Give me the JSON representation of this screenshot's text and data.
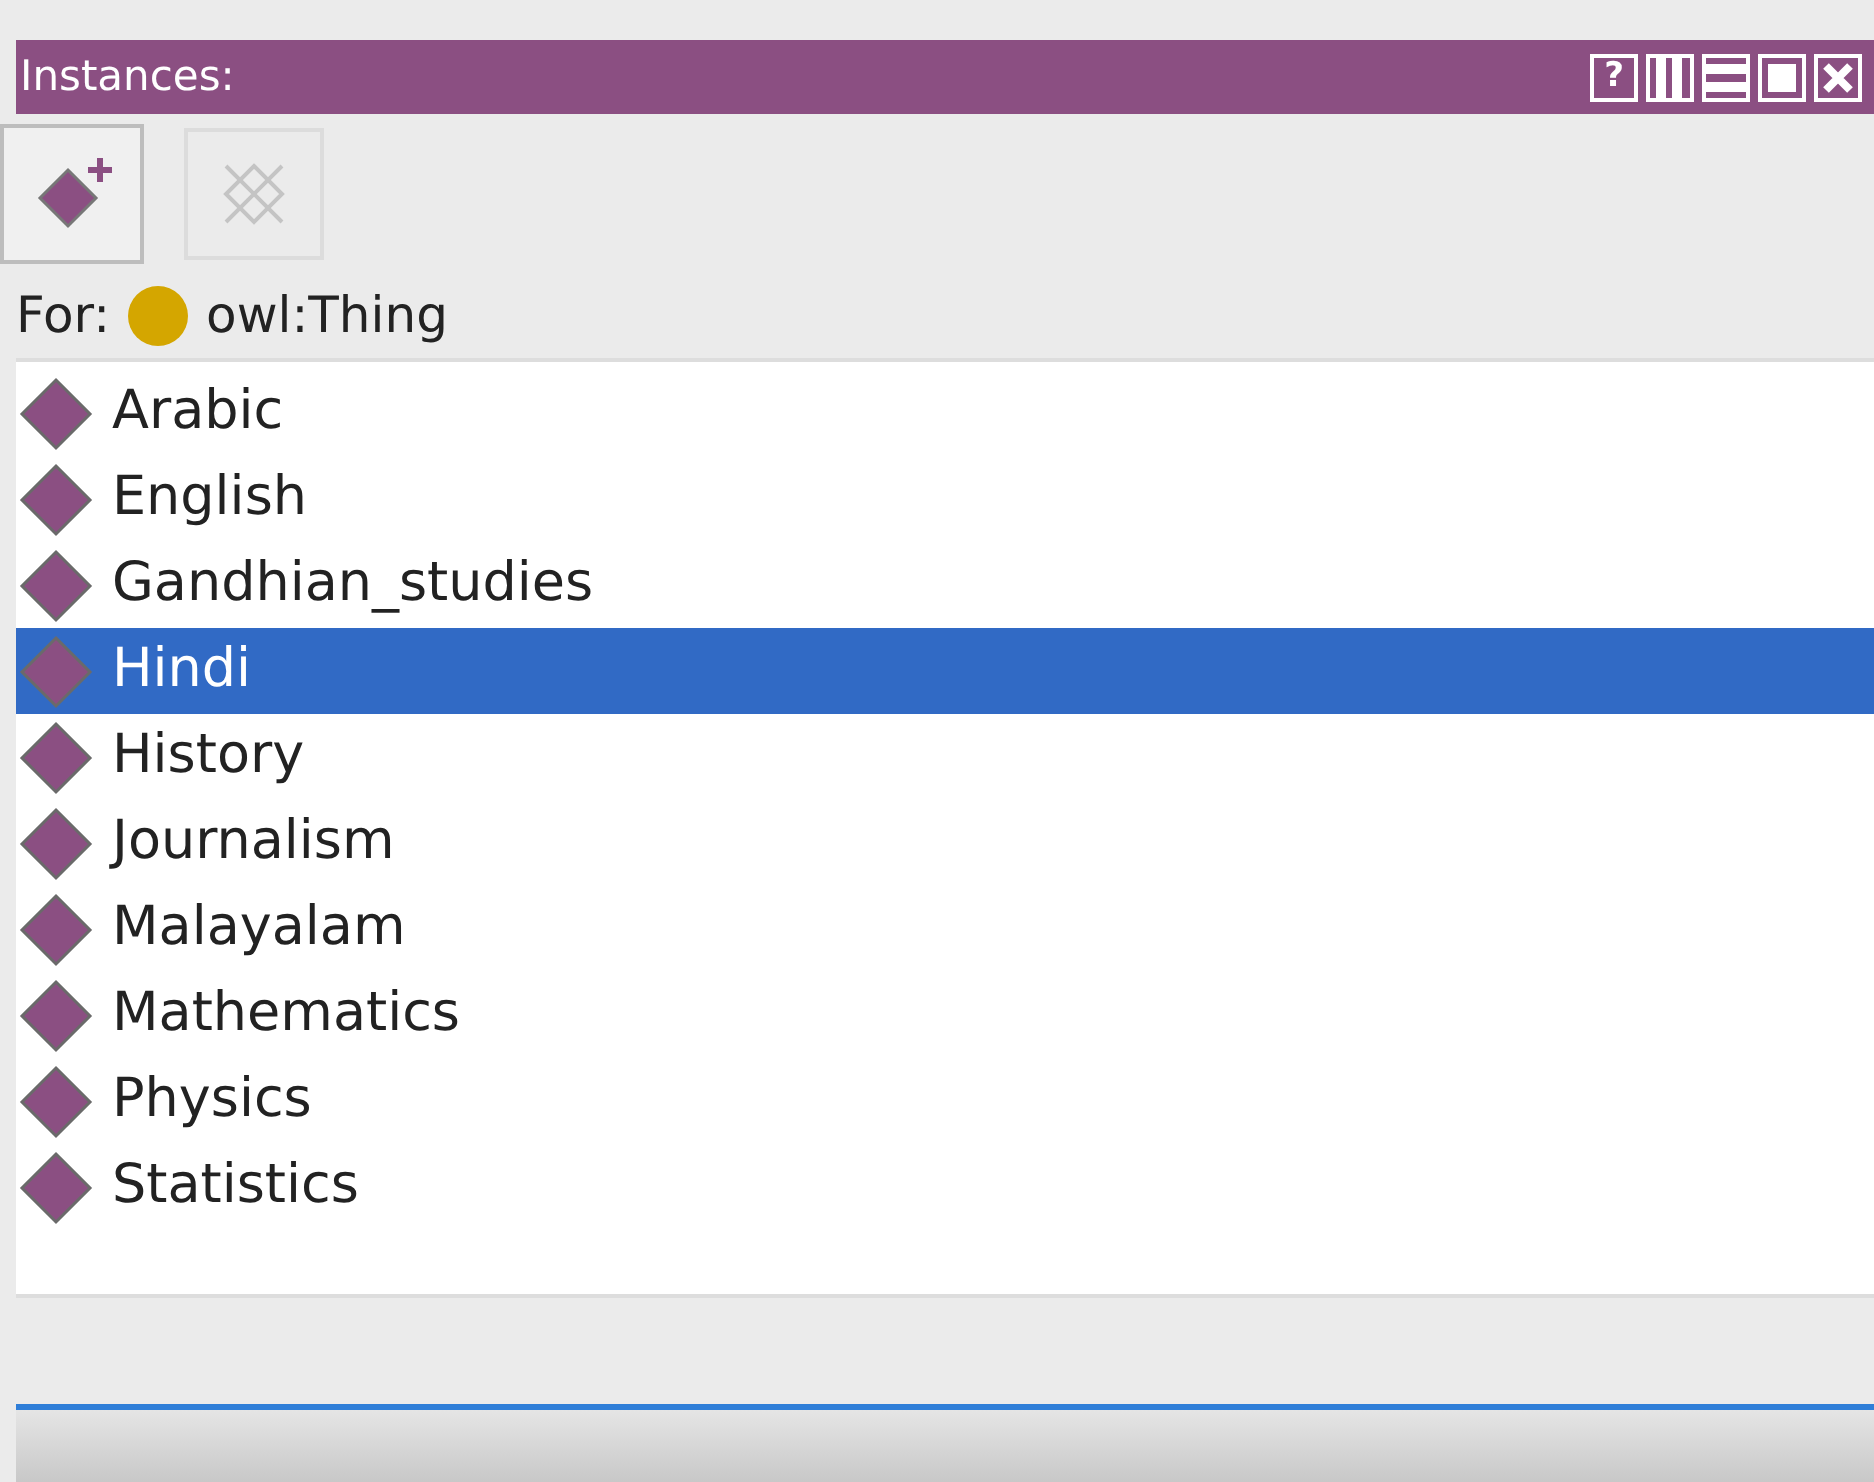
{
  "window": {
    "title": "Instances:",
    "help": "?"
  },
  "toolbar": [
    {
      "kind": "add",
      "disabled": false
    },
    {
      "kind": "delete",
      "disabled": true
    }
  ],
  "for_label": "For:",
  "for_class": "owl:Thing",
  "instances": [
    {
      "label": "Arabic",
      "selected": false
    },
    {
      "label": "English",
      "selected": false
    },
    {
      "label": "Gandhian_studies",
      "selected": false
    },
    {
      "label": "Hindi",
      "selected": true
    },
    {
      "label": "History",
      "selected": false
    },
    {
      "label": "Journalism",
      "selected": false
    },
    {
      "label": "Malayalam",
      "selected": false
    },
    {
      "label": "Mathematics",
      "selected": false
    },
    {
      "label": "Physics",
      "selected": false
    },
    {
      "label": "Statistics",
      "selected": false
    }
  ]
}
